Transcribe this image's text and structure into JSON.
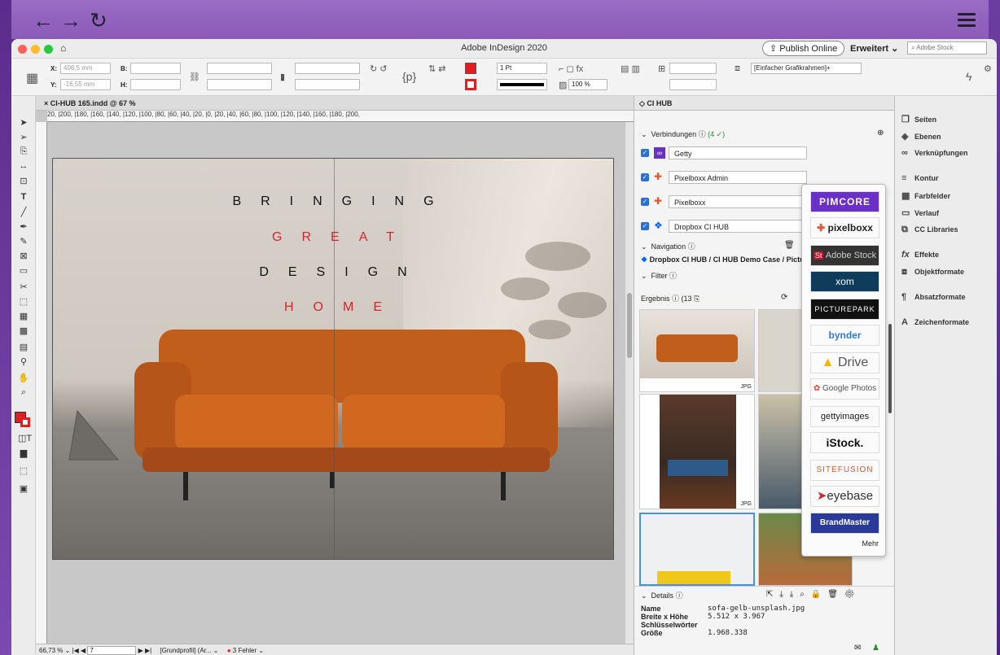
{
  "browser": {
    "back": "←",
    "forward": "→",
    "reload": "↻"
  },
  "app": {
    "title": "Adobe InDesign 2020",
    "publish": "Publish Online",
    "workspace": "Erweitert",
    "search_placeholder": "Adobe Stock"
  },
  "control": {
    "x_label": "X:",
    "x_value": "406,5 mm",
    "y_label": "Y:",
    "y_value": "-16,55 mm",
    "b_label": "B:",
    "h_label": "H:",
    "stroke": "1 Pt",
    "zoom": "100 %",
    "frame_style": "[Einfacher Grafikrahmen]+"
  },
  "doc": {
    "tab": "CI-HUB 165.indd @ 67 %",
    "ruler": "20,  |200,  |180,  |160,  |140,  |120,  |100,  |80,  |60,  |40,  |20,  |0,  |20,  |40,  |60,  |80,  |100,  |120,  |140,  |160,  |180,  |200,",
    "headline": [
      "BRINGING",
      "GREAT",
      "DESIGN",
      "HOME"
    ],
    "status": {
      "zoom": "66,73 %",
      "page": "7",
      "profile": "[Grundprofil] (Ar...",
      "errors": "3 Fehler"
    }
  },
  "cihub": {
    "title": "CI HUB",
    "connections_label": "Verbindungen",
    "connections_count": "(4 ✓)",
    "connections": [
      "Getty",
      "Pixelboxx Admin",
      "Pixelboxx",
      "Dropbox CI HUB"
    ],
    "navigation_label": "Navigation",
    "breadcrumb": "Dropbox CI HUB / CI HUB Demo Case / Pictur",
    "filter_label": "Filter",
    "results_label": "Ergebnis",
    "results_count": "(13",
    "thumb_type": "JPG",
    "details_label": "Details",
    "details": [
      {
        "k": "Name",
        "v": "sofa-gelb-unsplash.jpg"
      },
      {
        "k": "Breite x Höhe",
        "v": "5.512 x 3.967"
      },
      {
        "k": "Schlüsselwörter",
        "v": ""
      },
      {
        "k": "Größe",
        "v": "1.968.338"
      }
    ]
  },
  "providers": [
    "PIMCORE",
    "pixelboxx",
    "Adobe Stock",
    "xom",
    "PICTUREPARK",
    "bynder",
    "Drive",
    "Google Photos",
    "gettyimages",
    "iStock.",
    "SITEFUSION",
    "eyebase",
    "BrandMaster"
  ],
  "providers_more": "Mehr",
  "right_panels": [
    "Seiten",
    "Ebenen",
    "Verknüpfungen",
    "Kontur",
    "Farbfelder",
    "Verlauf",
    "CC Libraries",
    "Effekte",
    "Objektformate",
    "Absatzformate",
    "Zeichenformate"
  ],
  "colors": {
    "accent_red": "#e02020",
    "ci_blue": "#2a6fdb"
  }
}
